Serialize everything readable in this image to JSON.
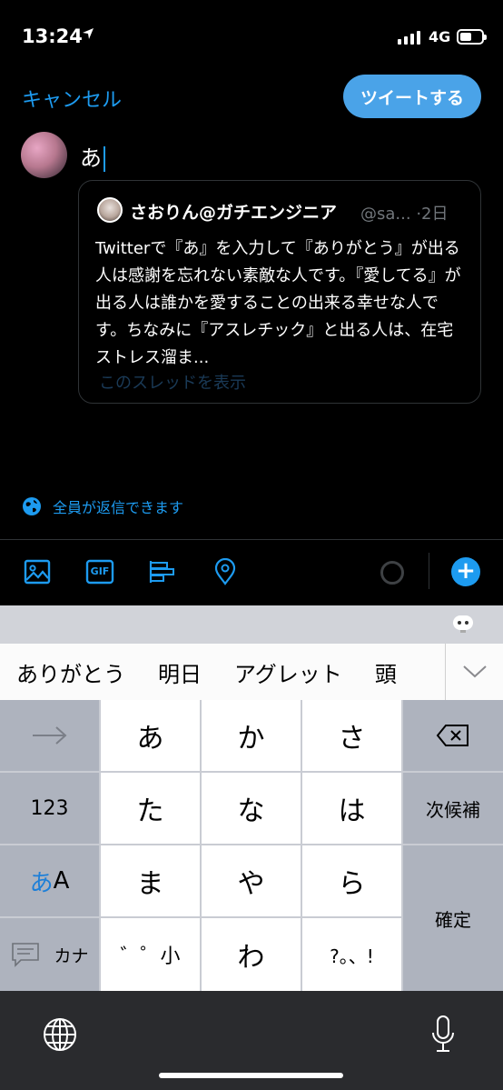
{
  "status_bar": {
    "time": "13:24",
    "network": "4G"
  },
  "header": {
    "cancel_label": "キャンセル",
    "tweet_label": "ツイートする"
  },
  "compose": {
    "text": "あ"
  },
  "quoted_tweet": {
    "name": "さおりん@ガチエンジニア",
    "handle": "@sa...",
    "time_sep": "·",
    "age": "2日",
    "body": "Twitterで『あ』を入力して『ありがとう』が出る人は感謝を忘れない素敵な人です。『愛してる』が出る人は誰かを愛することの出来る幸せな人です。ちなみに『アスレチック』と出る人は、在宅ストレス溜ま...",
    "thread_link": "このスレッドを表示"
  },
  "reply_setting": {
    "label": "全員が返信できます"
  },
  "toolbar": {
    "icons": [
      "image-icon",
      "gif-icon",
      "poll-icon",
      "location-icon"
    ],
    "gif_label": "GIF"
  },
  "keyboard": {
    "candidates": [
      "ありがとう",
      "明日",
      "アグレット",
      "頭"
    ],
    "keys": {
      "r1": [
        "あ",
        "か",
        "さ"
      ],
      "r2": [
        "た",
        "な",
        "は"
      ],
      "r3": [
        "ま",
        "や",
        "ら"
      ],
      "r4": [
        "゛゜小",
        "わ",
        "?。、!"
      ]
    },
    "left": {
      "numbers": "123",
      "kana_a": "あ",
      "kana_A": "A",
      "kana_label": "カナ"
    },
    "right": {
      "next_candidate": "次候補",
      "confirm": "確定"
    }
  },
  "colors": {
    "accent": "#1d9bf0",
    "background": "#000000"
  }
}
